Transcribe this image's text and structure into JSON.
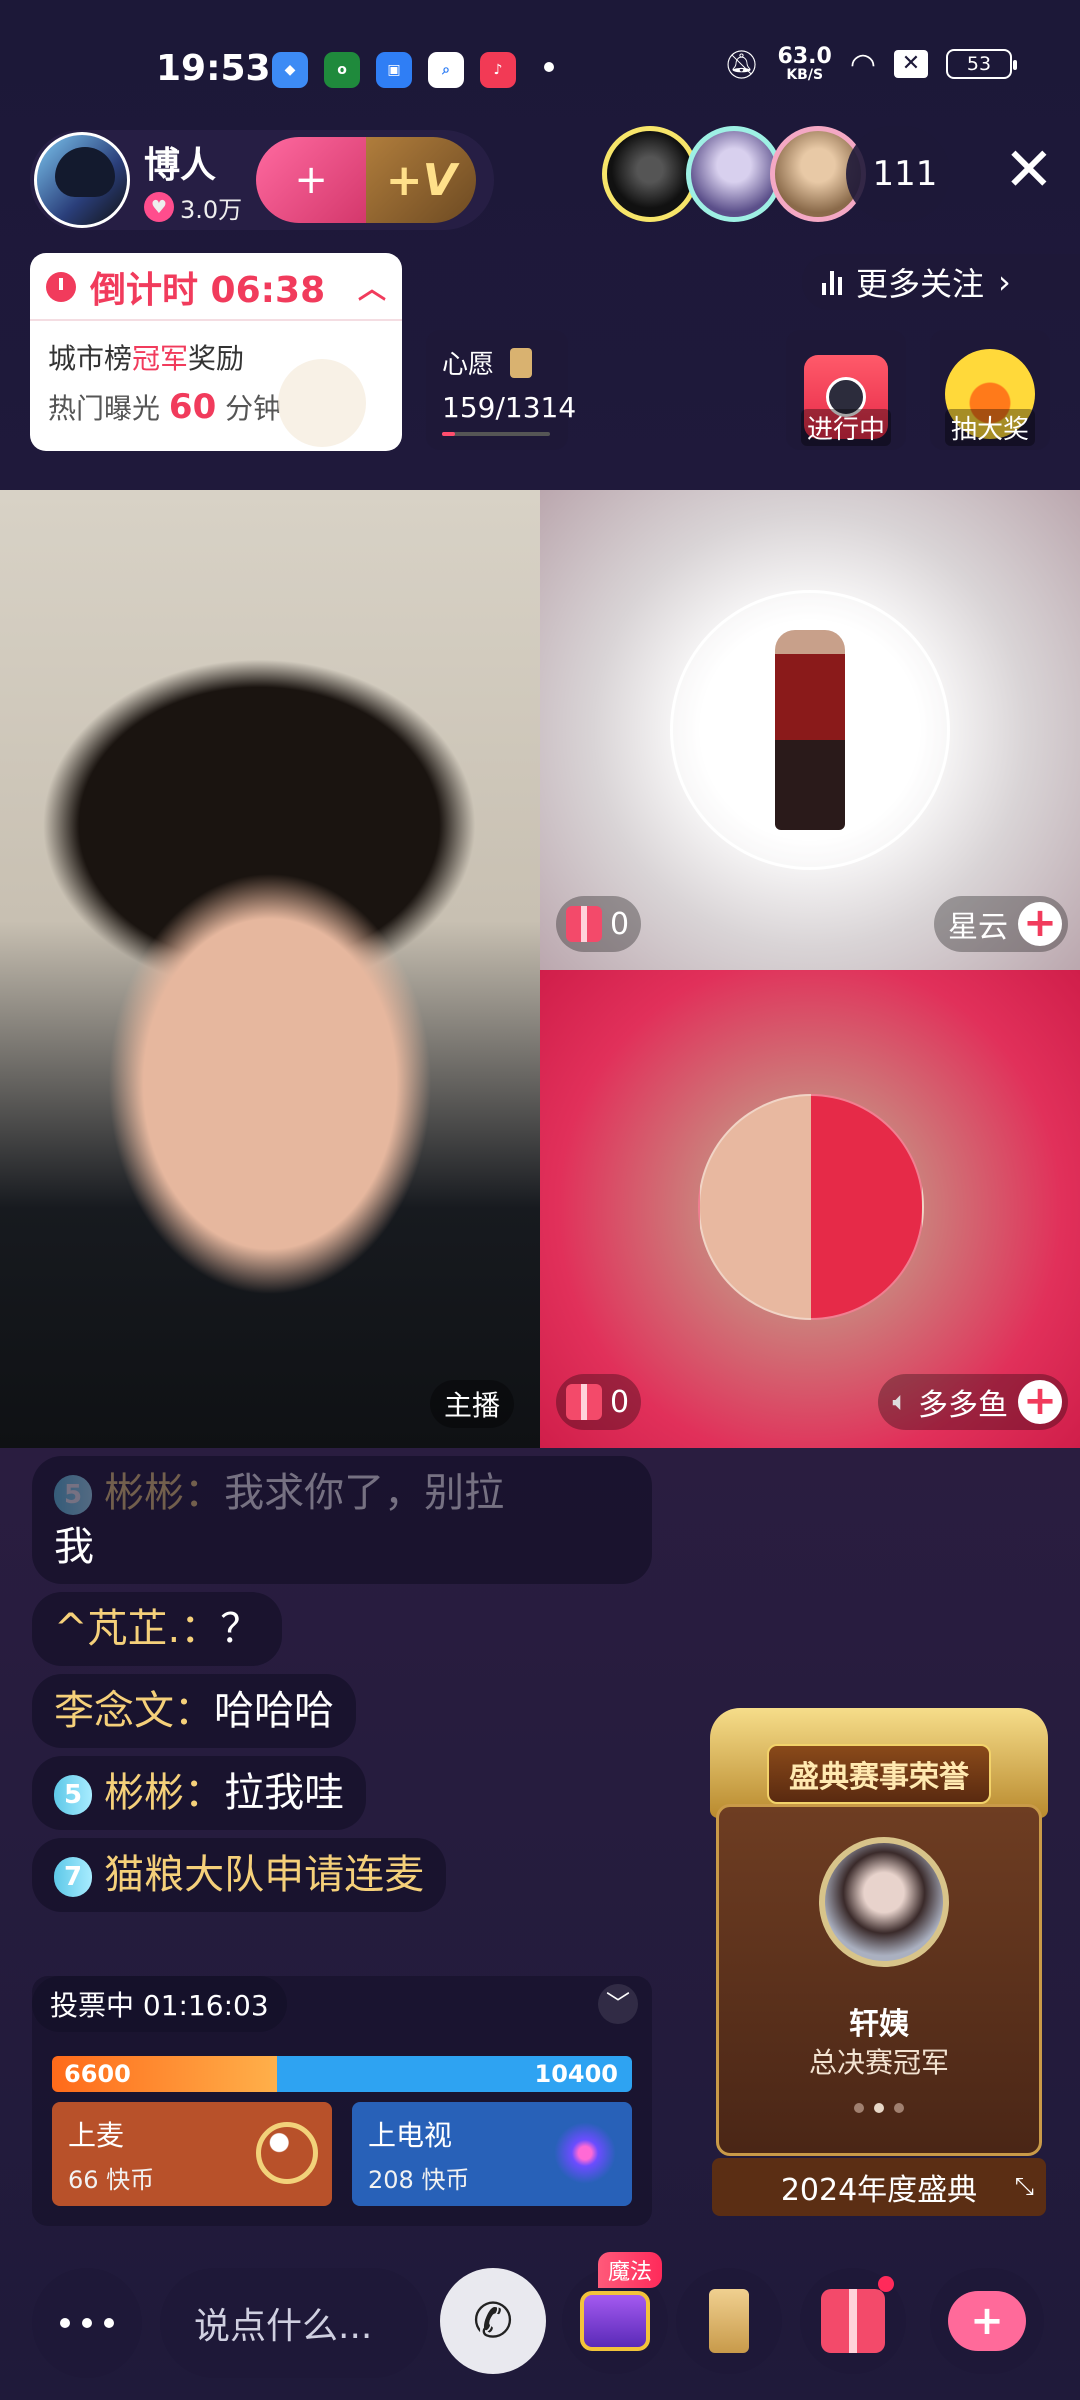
{
  "status_bar": {
    "time": "19:53",
    "network_speed": "63.0",
    "network_unit": "KB/S",
    "battery": "53",
    "app_icons": [
      "bird-app-icon",
      "oppo-app-icon",
      "store-app-icon",
      "search-app-icon",
      "music-app-icon"
    ]
  },
  "host": {
    "name": "博人",
    "fans": "3.0万",
    "follow_symbol": "+",
    "vip_symbol": "+V"
  },
  "viewers": {
    "count": "111"
  },
  "countdown": {
    "title": "倒计时 06:38",
    "line1_prefix": "城市榜",
    "line1_highlight": "冠军",
    "line1_suffix": "奖励",
    "line2_prefix": "热门曝光",
    "line2_number": "60",
    "line2_suffix": "分钟"
  },
  "wish": {
    "label": "心愿",
    "value": "159/1314",
    "progress": 0.121
  },
  "more_follow": {
    "label": "更多关注"
  },
  "activities": [
    {
      "label": "进行中"
    },
    {
      "label": "抽大奖"
    }
  ],
  "video": {
    "host_tag": "主播",
    "guest1": {
      "gifts": "0",
      "name": "星云"
    },
    "guest2": {
      "gifts": "0",
      "name": "多多鱼"
    }
  },
  "chat": [
    {
      "level": "5",
      "name": "彬彬：",
      "text": "我求你了，别拉",
      "text2": "我"
    },
    {
      "name": "^芃芷.：",
      "text": "？"
    },
    {
      "name": "李念文：",
      "text": "哈哈哈"
    },
    {
      "level": "5",
      "name": "彬彬：",
      "text": "拉我哇"
    },
    {
      "level": "7",
      "name": "猫粮大队申请连麦",
      "text": ""
    }
  ],
  "vote": {
    "status": "投票中 01:16:03",
    "left_value": "6600",
    "right_value": "10400",
    "option1": {
      "title": "上麦",
      "cost": "66 快币"
    },
    "option2": {
      "title": "上电视",
      "cost": "208 快币"
    }
  },
  "honor": {
    "title": "盛典赛事荣誉",
    "name": "轩姨",
    "subtitle": "总决赛冠军",
    "footer": "2024年度盛典",
    "page_index": 2,
    "page_count": 3
  },
  "bottom": {
    "input_placeholder": "说点什么...",
    "magic_tag": "魔法"
  },
  "colors": {
    "accent_red": "#f13b5c",
    "gold": "#f5d07a",
    "vote_orange": "#ff6a1a",
    "vote_blue": "#2ea3f2"
  }
}
